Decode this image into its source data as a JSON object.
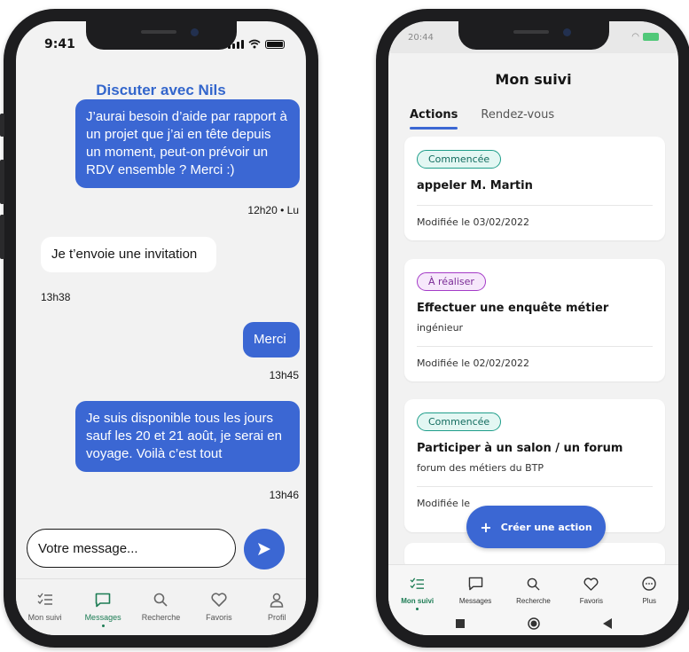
{
  "left_phone": {
    "status_time": "9:41",
    "chat_title": "Discuter avec Nils",
    "messages": [
      {
        "text": "J’aurai besoin d’aide par rapport à un projet que j’ai en tête depuis un moment, peut-on prévoir un RDV ensemble ? Merci :)",
        "meta": "12h20 • Lu"
      },
      {
        "text": "Je t’envoie une invitation",
        "meta": "13h38"
      },
      {
        "text": "Merci",
        "meta": "13h45"
      },
      {
        "text": "Je suis disponible tous les jours sauf les 20 et 21 août, je serai en voyage. Voilà c’est tout",
        "meta": "13h46"
      }
    ],
    "composer_text": "Votre message...",
    "tabs": [
      {
        "label": "Mon suivi",
        "icon": "checklist-icon"
      },
      {
        "label": "Messages",
        "icon": "chat-icon"
      },
      {
        "label": "Recherche",
        "icon": "search-icon"
      },
      {
        "label": "Favoris",
        "icon": "heart-icon"
      },
      {
        "label": "Profil",
        "icon": "user-icon"
      }
    ]
  },
  "right_phone": {
    "status_time": "20:44",
    "title": "Mon suivi",
    "tabs": [
      "Actions",
      "Rendez-vous"
    ],
    "cards": [
      {
        "badge": "Commencée",
        "title": "appeler M. Martin",
        "subtitle": "",
        "date": "Modifiée le 03/02/2022"
      },
      {
        "badge": "À réaliser",
        "title": "Effectuer une enquête métier",
        "subtitle": "ingénieur",
        "date": "Modifiée le 02/02/2022"
      },
      {
        "badge": "Commencée",
        "title": "Participer à un salon / un forum",
        "subtitle": "forum des métiers du BTP",
        "date": "Modifiée le"
      }
    ],
    "fab_label": "Créer une action",
    "bottom_tabs": [
      {
        "label": "Mon suivi",
        "icon": "checklist-icon"
      },
      {
        "label": "Messages",
        "icon": "chat-icon"
      },
      {
        "label": "Recherche",
        "icon": "search-icon"
      },
      {
        "label": "Favoris",
        "icon": "heart-icon"
      },
      {
        "label": "Plus",
        "icon": "more-icon"
      }
    ]
  },
  "colors": {
    "primary_blue": "#3b67d3",
    "active_green": "#1c7c54",
    "badge_green": "#1f9e8a",
    "badge_purple": "#a43bc7"
  }
}
